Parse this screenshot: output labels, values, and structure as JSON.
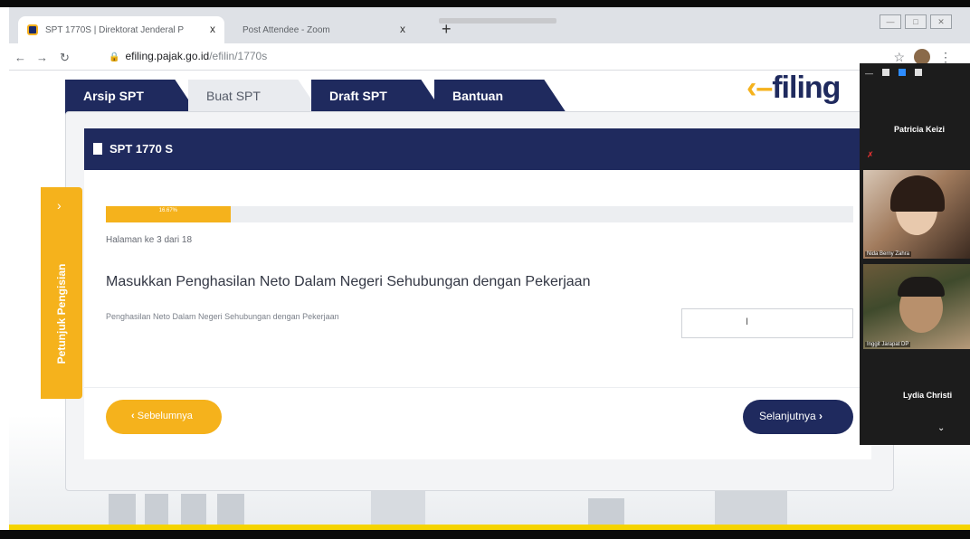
{
  "browser": {
    "tabs": [
      {
        "title": "SPT 1770S | Direktorat Jenderal P",
        "close": "x"
      },
      {
        "title": "Post Attendee - Zoom",
        "close": "x"
      }
    ],
    "new_tab": "+",
    "url_domain": "efiling.pajak.go.id",
    "url_path": "/efilin/1770s"
  },
  "app": {
    "logo_text": "filing",
    "tabs": [
      {
        "label": "Arsip SPT"
      },
      {
        "label": "Buat SPT"
      },
      {
        "label": "Draft SPT"
      },
      {
        "label": "Bantuan"
      }
    ]
  },
  "form": {
    "header_title": "SPT 1770 S",
    "progress": {
      "percent": 16.67,
      "label": "16.67%"
    },
    "page_indicator": "Halaman ke 3 dari 18",
    "question_title": "Masukkan Penghasilan Neto Dalam Negeri Sehubungan dengan Pekerjaan",
    "field_label": "Penghasilan Neto Dalam Negeri Sehubungan dengan Pekerjaan",
    "field_value": "",
    "prev_label": "Sebelumnya",
    "next_label": "Selanjutnya"
  },
  "helper": {
    "label": "Petunjuk Pengisian"
  },
  "zoom": {
    "participants": [
      {
        "name": "Patricia Keizi"
      },
      {
        "name": "Nida Berny Zahra"
      },
      {
        "name": "Inggit Jarapat DP"
      },
      {
        "name": "Lydia Christi"
      }
    ]
  },
  "colors": {
    "navy": "#1f2a5e",
    "yellow": "#f5b21c"
  }
}
